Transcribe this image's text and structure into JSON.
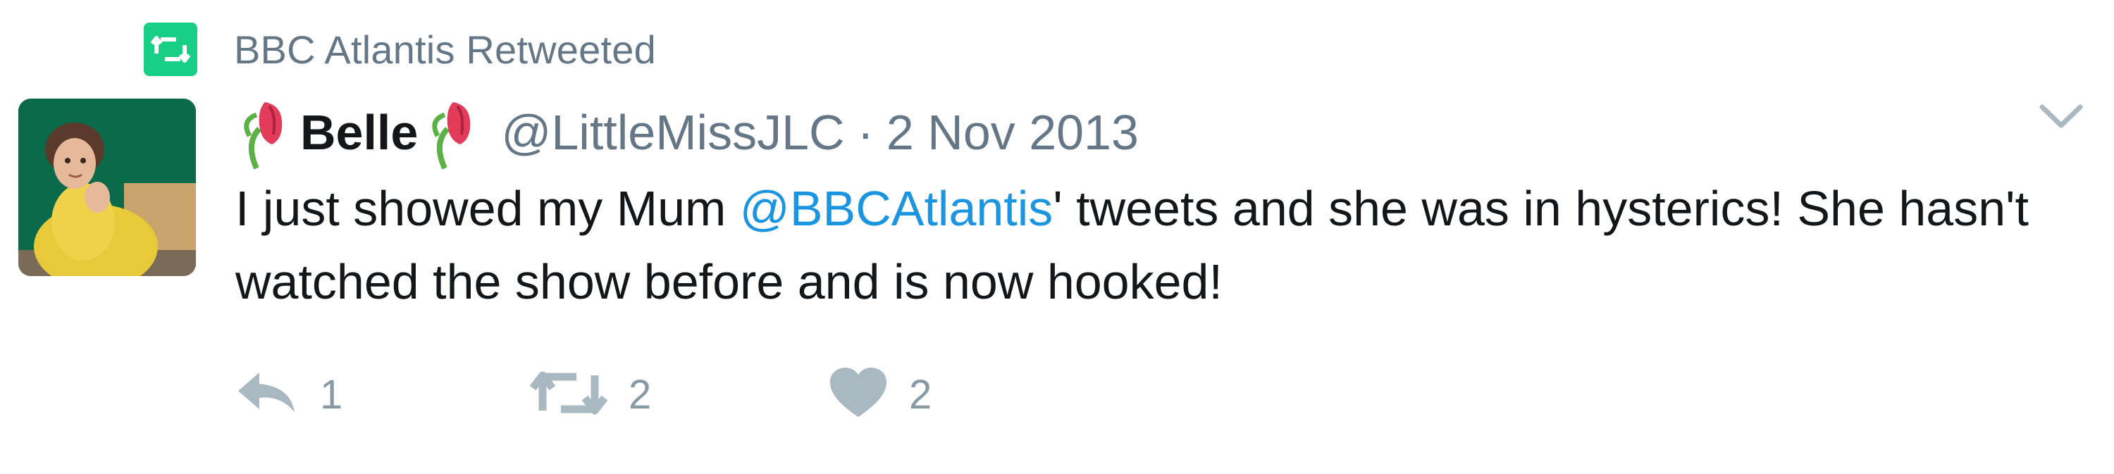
{
  "context": {
    "icon": "retweet-icon",
    "text": "BBC Atlantis Retweeted"
  },
  "tweet": {
    "author_name": "Belle",
    "name_emoji": "tulip-emoji",
    "handle": "@LittleMissJLC",
    "separator": "·",
    "date": "2 Nov 2013",
    "text_before": "I just showed my Mum ",
    "mention": "@BBCAtlantis",
    "text_after": "' tweets and she was in hysterics! She hasn't watched the show before and is now hooked!"
  },
  "actions": {
    "reply": {
      "icon": "reply-icon",
      "count": "1"
    },
    "retweet": {
      "icon": "retweet-icon",
      "count": "2"
    },
    "like": {
      "icon": "heart-icon",
      "count": "2"
    }
  },
  "colors": {
    "retweet_badge": "#19cf86",
    "mention": "#1b95e0",
    "muted": "#657786",
    "action_gray": "#8899a6"
  }
}
